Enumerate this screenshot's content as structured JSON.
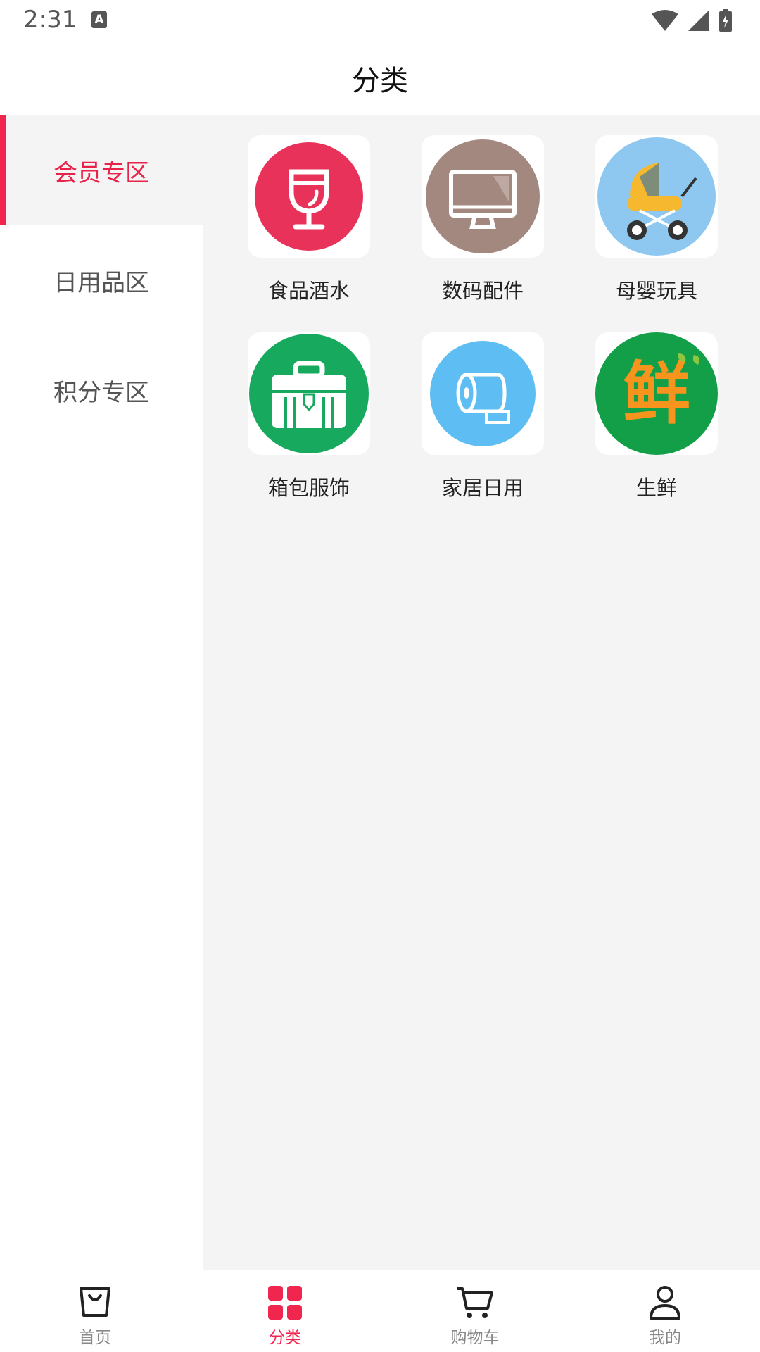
{
  "status_bar": {
    "time": "2:31",
    "notification_icon": "A"
  },
  "header": {
    "title": "分类"
  },
  "sidebar": {
    "items": [
      {
        "label": "会员专区",
        "active": true
      },
      {
        "label": "日用品区",
        "active": false
      },
      {
        "label": "积分专区",
        "active": false
      }
    ]
  },
  "categories": [
    {
      "label": "食品酒水",
      "icon": "wine-glass-icon",
      "color": "#e8325a"
    },
    {
      "label": "数码配件",
      "icon": "monitor-icon",
      "color": "#a38880"
    },
    {
      "label": "母婴玩具",
      "icon": "stroller-icon",
      "color": "#8ec8f0"
    },
    {
      "label": "箱包服饰",
      "icon": "briefcase-icon",
      "color": "#17a95e"
    },
    {
      "label": "家居日用",
      "icon": "tissue-roll-icon",
      "color": "#5ebdf2"
    },
    {
      "label": "生鲜",
      "icon": "fresh-icon",
      "color": "#139f48",
      "icon_text": "鲜"
    }
  ],
  "bottom_nav": {
    "items": [
      {
        "label": "首页",
        "icon": "shopping-bag-icon",
        "active": false
      },
      {
        "label": "分类",
        "icon": "grid-icon",
        "active": true
      },
      {
        "label": "购物车",
        "icon": "cart-icon",
        "active": false
      },
      {
        "label": "我的",
        "icon": "user-icon",
        "active": false
      }
    ]
  },
  "colors": {
    "accent": "#f0264f",
    "content_bg": "#f4f4f4"
  }
}
